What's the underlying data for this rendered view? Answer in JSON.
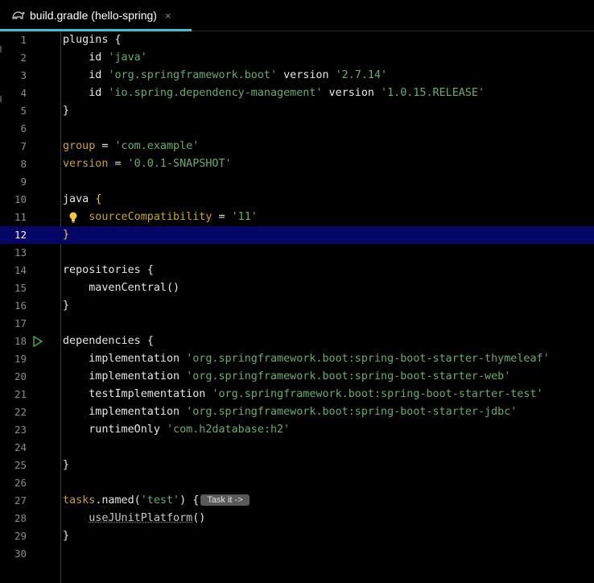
{
  "tab": {
    "title": "build.gradle (hello-spring)",
    "close": "×"
  },
  "lines": [
    {
      "n": "1",
      "parts": [
        {
          "t": "plugins ",
          "c": "kw"
        },
        {
          "t": "{",
          "c": "op"
        }
      ]
    },
    {
      "n": "2",
      "parts": [
        {
          "t": "    id ",
          "c": "kw"
        },
        {
          "t": "'java'",
          "c": "str"
        }
      ]
    },
    {
      "n": "3",
      "parts": [
        {
          "t": "    id ",
          "c": "kw"
        },
        {
          "t": "'org.springframework.boot'",
          "c": "str"
        },
        {
          "t": " version ",
          "c": "kw"
        },
        {
          "t": "'2.7.14'",
          "c": "str"
        }
      ]
    },
    {
      "n": "4",
      "parts": [
        {
          "t": "    id ",
          "c": "kw"
        },
        {
          "t": "'io.spring.dependency-management'",
          "c": "str"
        },
        {
          "t": " version ",
          "c": "kw"
        },
        {
          "t": "'1.0.15.RELEASE'",
          "c": "str"
        }
      ]
    },
    {
      "n": "5",
      "parts": [
        {
          "t": "}",
          "c": "op"
        }
      ]
    },
    {
      "n": "6",
      "parts": []
    },
    {
      "n": "7",
      "parts": [
        {
          "t": "group",
          "c": "prop"
        },
        {
          "t": " = ",
          "c": "op"
        },
        {
          "t": "'com.example'",
          "c": "str"
        }
      ]
    },
    {
      "n": "8",
      "parts": [
        {
          "t": "version",
          "c": "prop"
        },
        {
          "t": " = ",
          "c": "op"
        },
        {
          "t": "'0.0.1-SNAPSHOT'",
          "c": "str"
        }
      ]
    },
    {
      "n": "9",
      "parts": []
    },
    {
      "n": "10",
      "parts": [
        {
          "t": "java ",
          "c": "kw"
        },
        {
          "t": "{",
          "c": "brace-hl"
        }
      ]
    },
    {
      "n": "11",
      "parts": [
        {
          "t": "    ",
          "c": "kw"
        },
        {
          "t": "sourceCompatibility",
          "c": "prop"
        },
        {
          "t": " = ",
          "c": "op"
        },
        {
          "t": "'11'",
          "c": "str"
        }
      ],
      "bulb": true
    },
    {
      "n": "12",
      "parts": [
        {
          "t": "}",
          "c": "brace-hl"
        }
      ],
      "current": true
    },
    {
      "n": "13",
      "parts": []
    },
    {
      "n": "14",
      "parts": [
        {
          "t": "repositories ",
          "c": "kw"
        },
        {
          "t": "{",
          "c": "op"
        }
      ]
    },
    {
      "n": "15",
      "parts": [
        {
          "t": "    mavenCentral()",
          "c": "kw"
        }
      ]
    },
    {
      "n": "16",
      "parts": [
        {
          "t": "}",
          "c": "op"
        }
      ]
    },
    {
      "n": "17",
      "parts": []
    },
    {
      "n": "18",
      "parts": [
        {
          "t": "dependencies ",
          "c": "kw"
        },
        {
          "t": "{",
          "c": "op"
        }
      ],
      "run": true
    },
    {
      "n": "19",
      "parts": [
        {
          "t": "    implementation ",
          "c": "kw"
        },
        {
          "t": "'org.springframework.boot:spring-boot-starter-thymeleaf'",
          "c": "str"
        }
      ]
    },
    {
      "n": "20",
      "parts": [
        {
          "t": "    implementation ",
          "c": "kw"
        },
        {
          "t": "'org.springframework.boot:spring-boot-starter-web'",
          "c": "str"
        }
      ]
    },
    {
      "n": "21",
      "parts": [
        {
          "t": "    testImplementation ",
          "c": "kw"
        },
        {
          "t": "'org.springframework.boot:spring-boot-starter-test'",
          "c": "str"
        }
      ]
    },
    {
      "n": "22",
      "parts": [
        {
          "t": "    implementation ",
          "c": "kw"
        },
        {
          "t": "'org.springframework.boot:spring-boot-starter-jdbc'",
          "c": "str"
        }
      ]
    },
    {
      "n": "23",
      "parts": [
        {
          "t": "    runtimeOnly ",
          "c": "kw"
        },
        {
          "t": "'com.h2database:h2'",
          "c": "str"
        }
      ]
    },
    {
      "n": "24",
      "parts": []
    },
    {
      "n": "25",
      "parts": [
        {
          "t": "}",
          "c": "op"
        }
      ]
    },
    {
      "n": "26",
      "parts": []
    },
    {
      "n": "27",
      "parts": [
        {
          "t": "tasks",
          "c": "prop"
        },
        {
          "t": ".named(",
          "c": "kw"
        },
        {
          "t": "'test'",
          "c": "str"
        },
        {
          "t": ") {",
          "c": "kw"
        }
      ],
      "hint": "Task it ->"
    },
    {
      "n": "28",
      "parts": [
        {
          "t": "    ",
          "c": "kw"
        },
        {
          "t": "useJUnitPlatform",
          "c": "dep"
        },
        {
          "t": "()",
          "c": "kw"
        }
      ]
    },
    {
      "n": "29",
      "parts": [
        {
          "t": "}",
          "c": "op"
        }
      ]
    },
    {
      "n": "30",
      "parts": []
    }
  ]
}
